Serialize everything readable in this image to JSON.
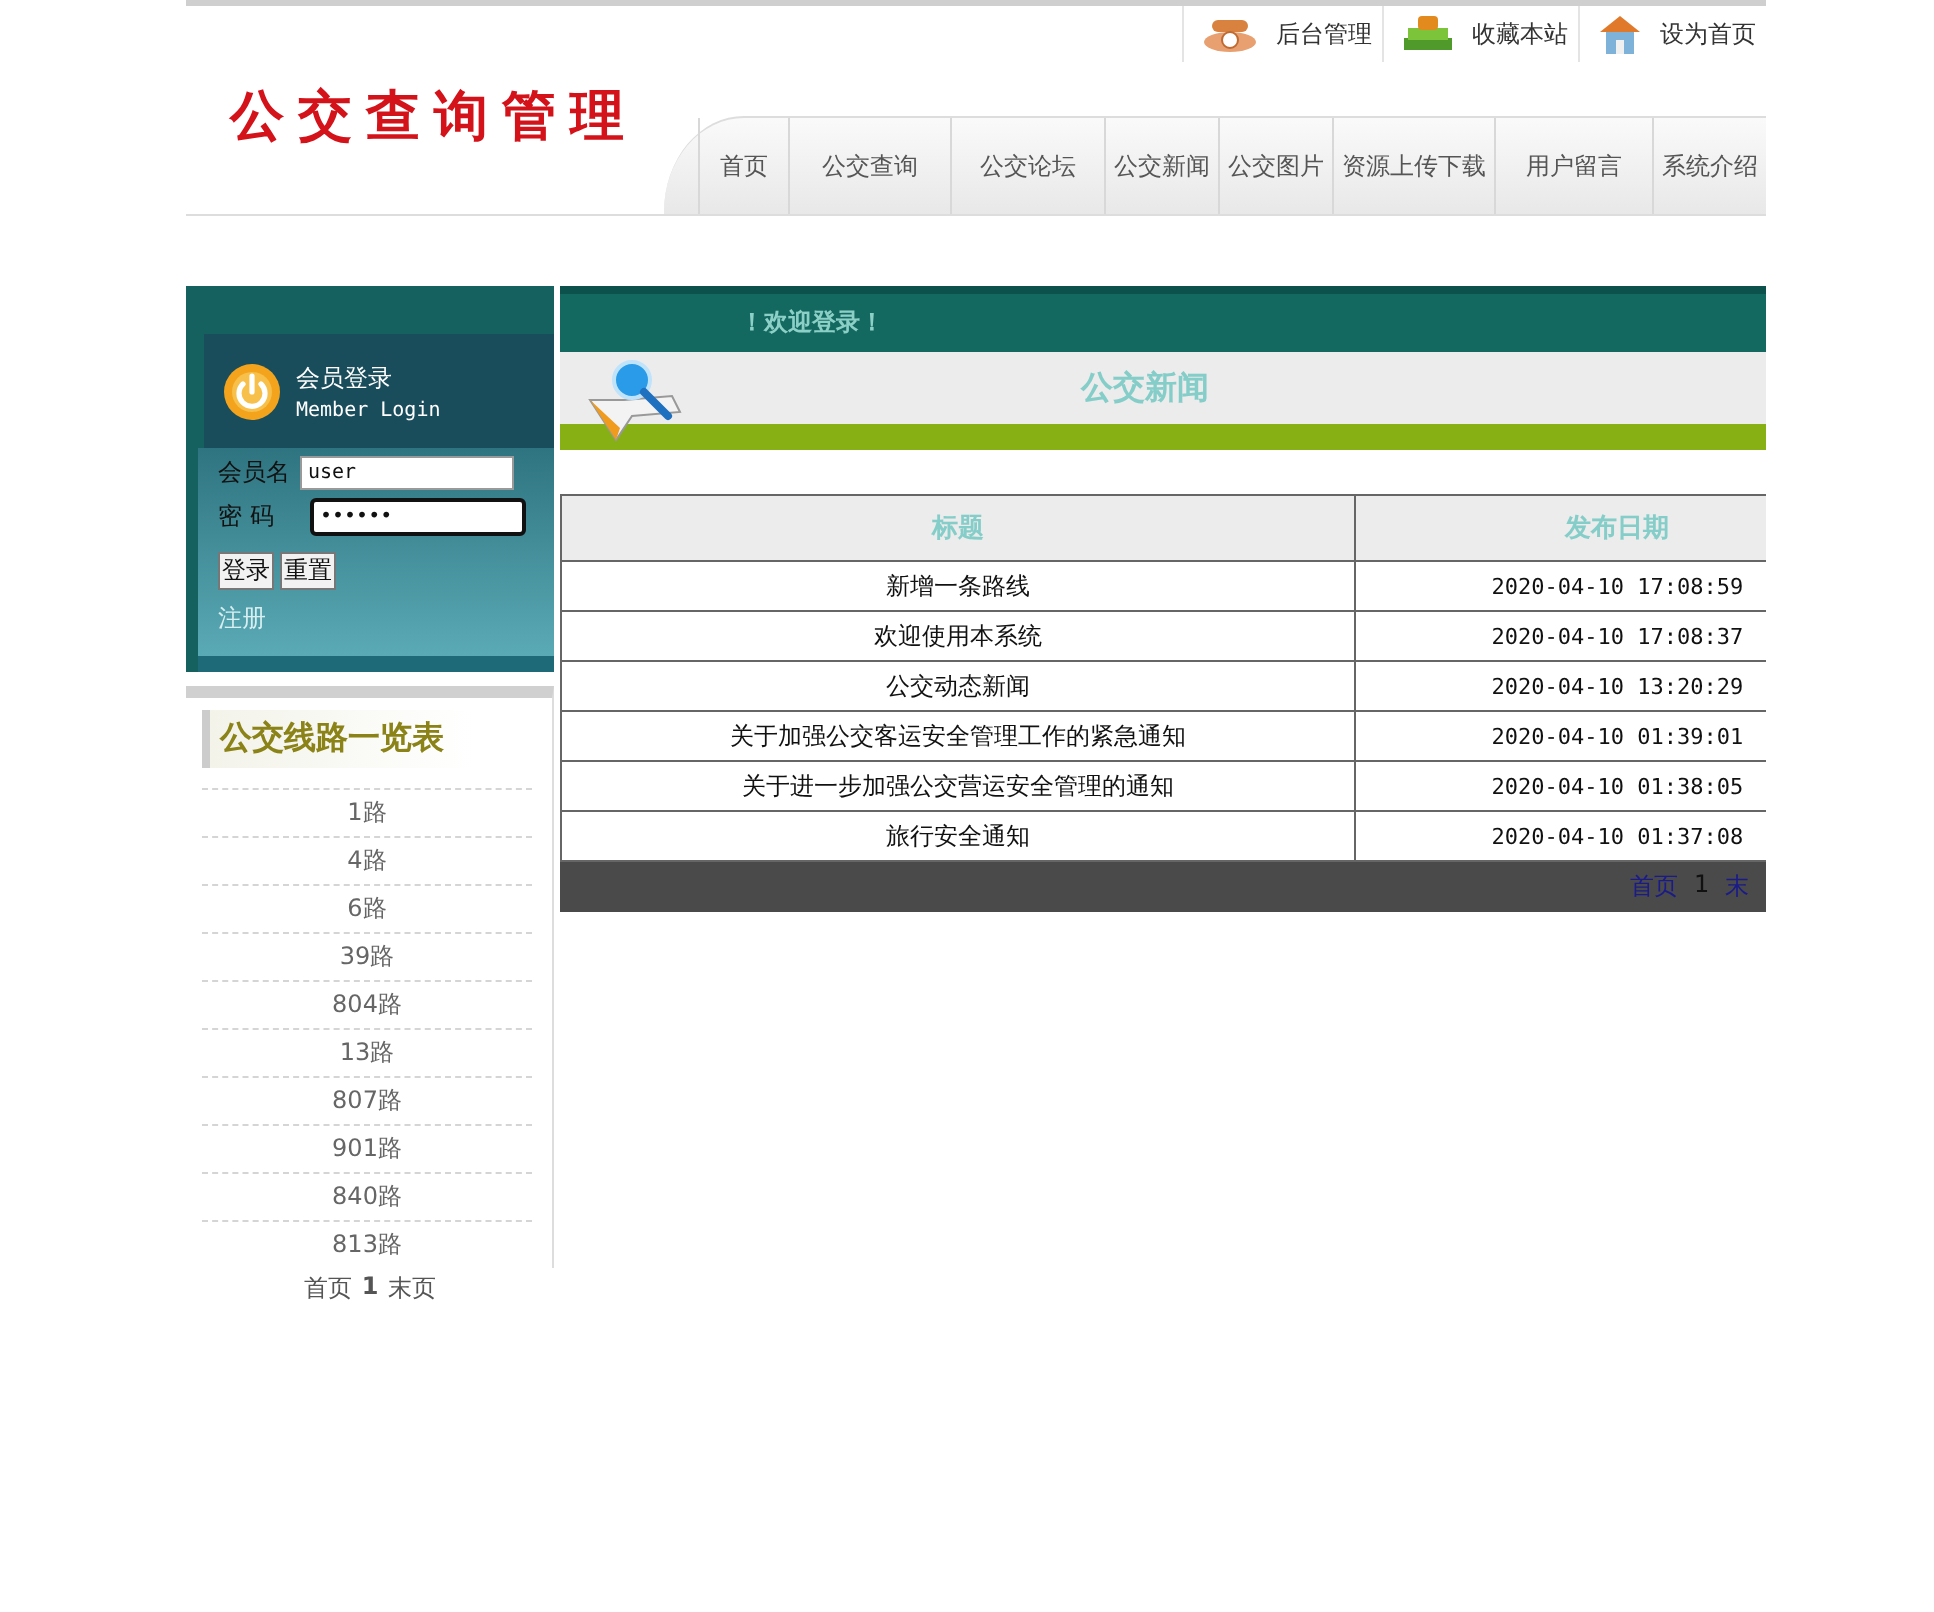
{
  "top_links": [
    {
      "kind": "phone",
      "label": "后台管理"
    },
    {
      "kind": "books",
      "label": "收藏本站"
    },
    {
      "kind": "house",
      "label": "设为首页"
    }
  ],
  "logo": "公交查询管理",
  "nav": [
    "首页",
    "公交查询",
    "公交论坛",
    "公交新闻",
    "公交图片",
    "资源上传下载",
    "用户留言",
    "系统介绍"
  ],
  "login": {
    "title": "会员登录",
    "subtitle": "Member Login",
    "username_label": "会员名",
    "username_value": "user",
    "password_label": "密 码",
    "password_value": "••••••",
    "buttons": [
      "登录",
      "重置"
    ],
    "register": "注册"
  },
  "routes": {
    "title": "公交线路一览表",
    "items": [
      "1路",
      "4路",
      "6路",
      "39路",
      "804路",
      "13路",
      "807路",
      "901路",
      "840路",
      "813路"
    ],
    "pager": [
      "首页",
      "1",
      "末页"
    ]
  },
  "welcome": "！欢迎登录！",
  "news": {
    "title": "公交新闻",
    "columns": [
      "标题",
      "发布日期"
    ],
    "rows": [
      {
        "title": "新增一条路线",
        "date": "2020-04-10 17:08:59"
      },
      {
        "title": "欢迎使用本系统",
        "date": "2020-04-10 17:08:37"
      },
      {
        "title": "公交动态新闻",
        "date": "2020-04-10 13:20:29"
      },
      {
        "title": "关于加强公交客运安全管理工作的紧急通知",
        "date": "2020-04-10 01:39:01"
      },
      {
        "title": "关于进一步加强公交营运安全管理的通知",
        "date": "2020-04-10 01:38:05"
      },
      {
        "title": "旅行安全通知",
        "date": "2020-04-10 01:37:08"
      }
    ],
    "pager": [
      "首页",
      "1",
      "末"
    ]
  }
}
